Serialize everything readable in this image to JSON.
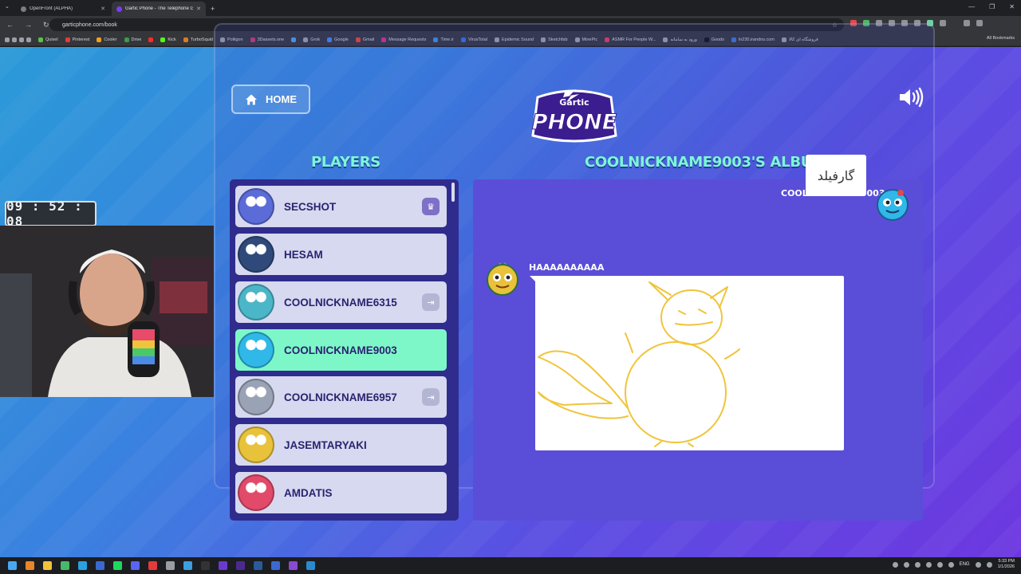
{
  "browser": {
    "tabs": [
      {
        "title": "OpenFront (ALPHA)",
        "active": false
      },
      {
        "title": "Gartic Phone - The Telephone G",
        "active": true
      }
    ],
    "url": "garticphone.com/book",
    "bookmarks": [
      "Quixel",
      "Pinterest",
      "Cooler",
      "Drive",
      "",
      "Kick",
      "TurboSquid",
      "Poliigon",
      "3Dassets.one",
      "",
      "Grok",
      "Google",
      "Gmail",
      "Message Requests",
      "Time.ir",
      "VirusTotal",
      "Epidemic Sound",
      "Sketchfab",
      "MinePic",
      "ASMR For People W...",
      "ورود به سامانه",
      "Goods",
      "ln230.irandns.com",
      "فروشگاه ای کالا"
    ],
    "all_bookmarks": "All Bookmarks"
  },
  "game": {
    "home_label": "HOME",
    "logo_top": "Gartic",
    "logo_main": "PHONE",
    "players_title": "PLAYERS",
    "album_title": "COOLNICKNAME9003'S ALBUM",
    "players": [
      {
        "name": "SECSHOT",
        "tag": "crown",
        "active": false,
        "avatar_color": "#5b6bd8"
      },
      {
        "name": "HESAM",
        "tag": "",
        "active": false,
        "avatar_color": "#2f4a7a"
      },
      {
        "name": "COOLNICKNAME6315",
        "tag": "ghost",
        "active": false,
        "avatar_color": "#4bb6c8"
      },
      {
        "name": "COOLNICKNAME9003",
        "tag": "",
        "active": true,
        "avatar_color": "#2fb8e8"
      },
      {
        "name": "COOLNICKNAME6957",
        "tag": "ghost",
        "active": false,
        "avatar_color": "#9aa3b5"
      },
      {
        "name": "JASEMTARYAKI",
        "tag": "",
        "active": false,
        "avatar_color": "#e8c23a"
      },
      {
        "name": "AMDATIS",
        "tag": "",
        "active": false,
        "avatar_color": "#e24a6a"
      }
    ],
    "album": {
      "entries": [
        {
          "author": "COOLNICKNAME9003",
          "type": "text",
          "text": "گارفیلد"
        },
        {
          "author": "HAAAAAAAAAA",
          "type": "drawing"
        }
      ]
    }
  },
  "stream": {
    "timer": "09 : 52 : 08"
  },
  "taskbar": {
    "lang": "ENG",
    "time": "5:33 PM",
    "date": "1/1/2026"
  },
  "colors": {
    "accent_green": "#7ef7c8",
    "title_mint": "#7cf7d4",
    "drawing_stroke": "#f0c43a",
    "panel_purple": "#2f2c8e"
  }
}
